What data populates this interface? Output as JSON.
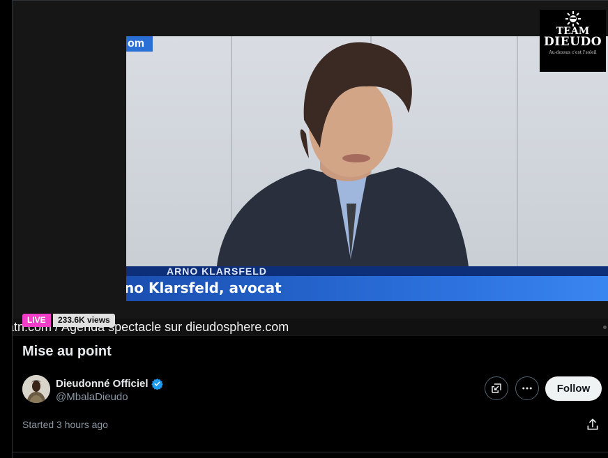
{
  "video": {
    "channel_bug": "om",
    "lower_third_top": "ARNO KLARSFELD",
    "lower_third_name": "no Klarsfeld, avocat"
  },
  "logo": {
    "line1": "TEAM",
    "line2": "DIEUDO",
    "tagline": "Au-dessus c'est l'soleil"
  },
  "stream": {
    "live_label": "LIVE",
    "views": "233.6K views",
    "ticker": "atn.com / Agenda spectacle sur dieudosphere.com",
    "title": "Mise au point"
  },
  "author": {
    "name": "Dieudonné Officiel",
    "handle": "@MbalaDieudo",
    "verified_icon": "verified-badge-icon"
  },
  "actions": {
    "follow_label": "Follow",
    "pip_icon": "picture-in-picture-icon",
    "more_icon": "more-options-icon",
    "share_icon": "share-icon"
  },
  "meta": {
    "started": "Started 3 hours ago"
  },
  "colors": {
    "live": "#f23dc8",
    "verified": "#1d9bf0",
    "background": "#000000"
  }
}
